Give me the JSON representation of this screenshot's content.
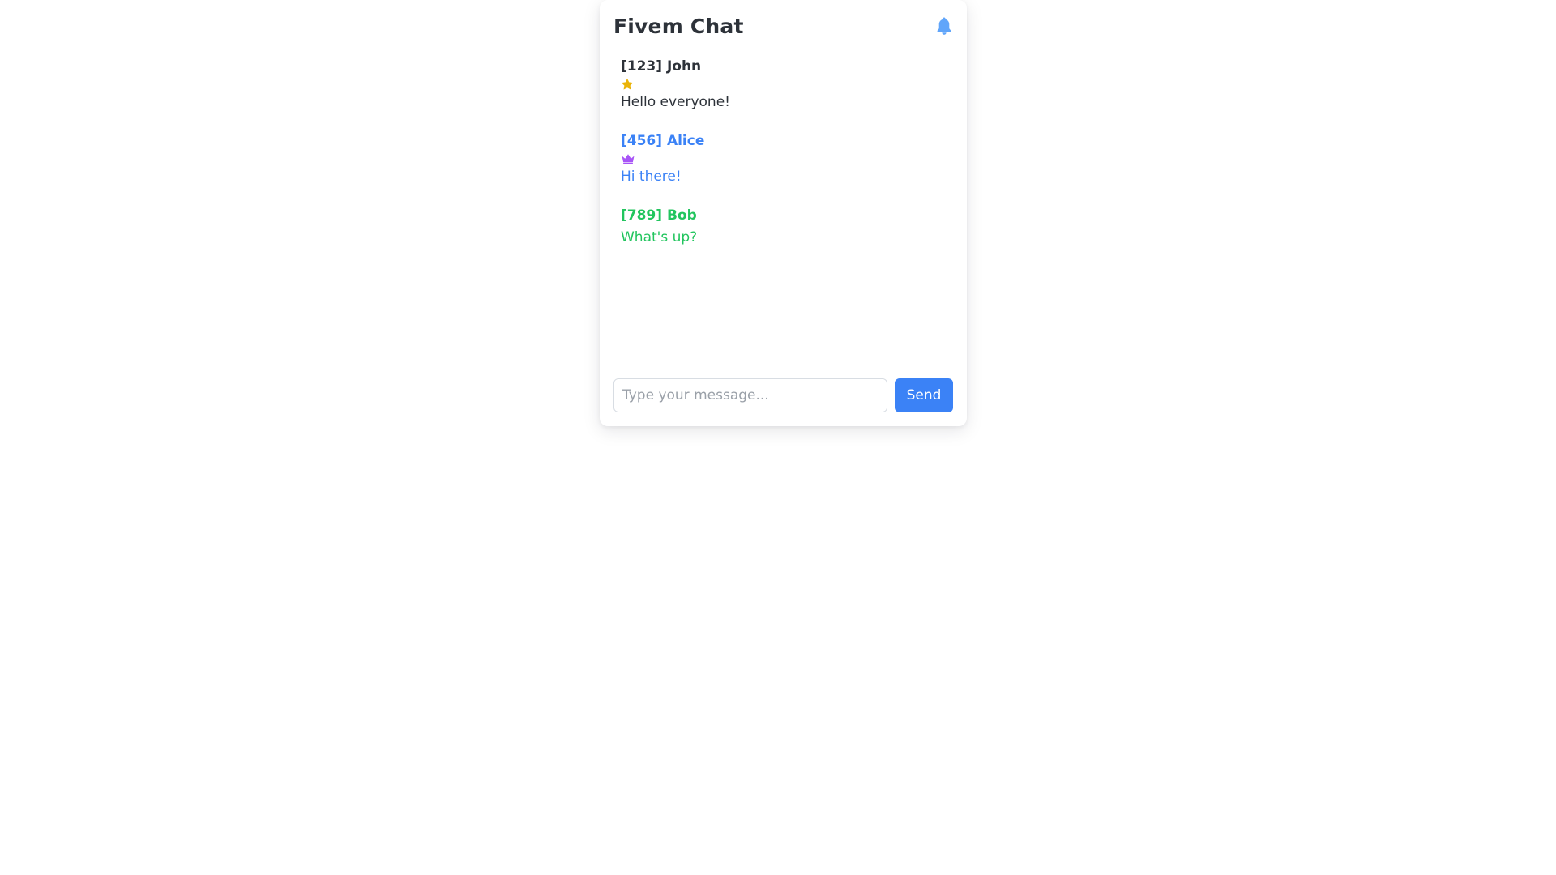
{
  "chat": {
    "title": "Fivem Chat",
    "notification_icon": "bell-icon",
    "messages": [
      {
        "author": "[123] John",
        "badge_icon": "star-icon",
        "badge_color": "#eab308",
        "text": "Hello everyone!",
        "color": "#2d3239"
      },
      {
        "author": "[456] Alice",
        "badge_icon": "crown-icon",
        "badge_color": "#a855f7",
        "text": "Hi there!",
        "color": "#3b82f6"
      },
      {
        "author": "[789] Bob",
        "badge_icon": "",
        "badge_color": "",
        "text": "What's up?",
        "color": "#22c55e"
      }
    ],
    "input": {
      "placeholder": "Type your message...",
      "value": ""
    },
    "send_label": "Send"
  },
  "colors": {
    "accent": "#3b82f6",
    "bell": "#60a5fa",
    "title": "#2d3239"
  }
}
